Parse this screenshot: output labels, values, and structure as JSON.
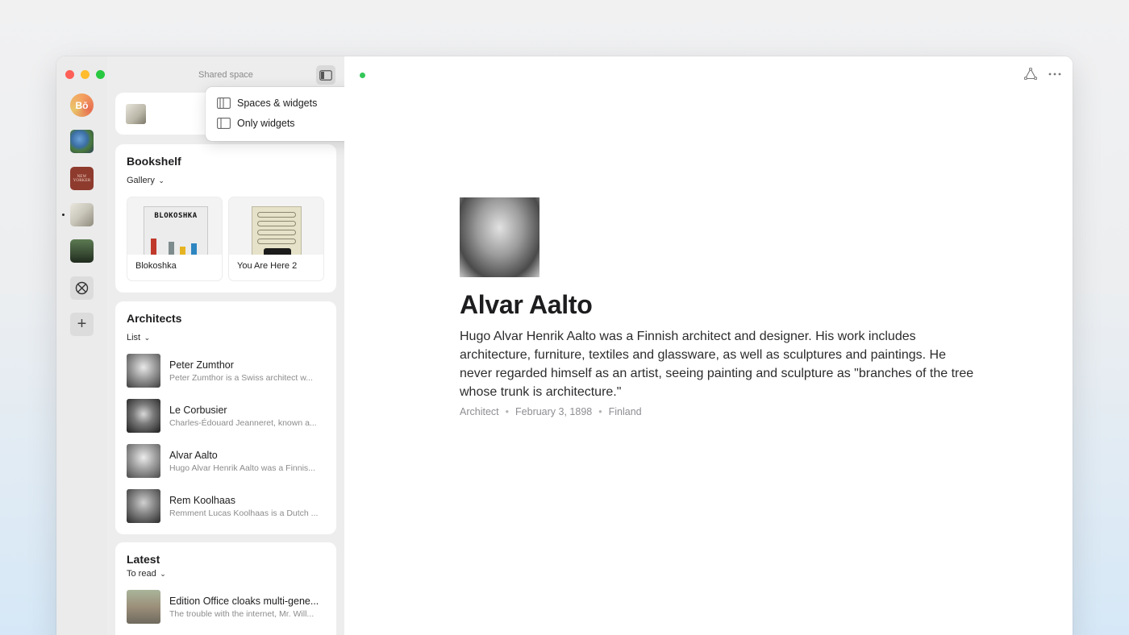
{
  "sidebar": {
    "title": "Shared space",
    "menu": [
      {
        "label": "Spaces & widgets",
        "checked": true
      },
      {
        "label": "Only widgets",
        "checked": false
      }
    ],
    "bookshelf": {
      "title": "Bookshelf",
      "view": "Gallery",
      "books": [
        {
          "label": "Blokoshka",
          "cover_title": "BLOKOSHKA"
        },
        {
          "label": "You Are Here 2"
        }
      ]
    },
    "architects": {
      "title": "Architects",
      "view": "List",
      "items": [
        {
          "name": "Peter Zumthor",
          "desc": "Peter Zumthor is a Swiss architect w..."
        },
        {
          "name": "Le Corbusier",
          "desc": "Charles-Édouard Jeanneret, known a..."
        },
        {
          "name": "Alvar Aalto",
          "desc": "Hugo Alvar Henrik Aalto was a Finnis..."
        },
        {
          "name": "Rem Koolhaas",
          "desc": "Remment Lucas Koolhaas is a Dutch ..."
        }
      ]
    },
    "latest": {
      "title": "Latest",
      "view": "To read",
      "items": [
        {
          "title": "Edition Office cloaks multi-gene...",
          "desc": "The trouble with the internet, Mr. Will..."
        }
      ]
    }
  },
  "rail": {
    "ny_label": "NEW YORKER"
  },
  "main": {
    "name": "Alvar Aalto",
    "bio": "Hugo Alvar Henrik Aalto was a Finnish architect and designer. His work includes architecture, furniture, textiles and glassware, as well as sculptures and paintings. He never regarded himself as an artist, seeing painting and sculpture as \"branches of the tree whose trunk is architecture.\"",
    "meta": {
      "role": "Architect",
      "date": "February 3, 1898",
      "country": "Finland"
    }
  },
  "colors": {
    "status": "#34c759",
    "accent_bg": "#ededed"
  }
}
